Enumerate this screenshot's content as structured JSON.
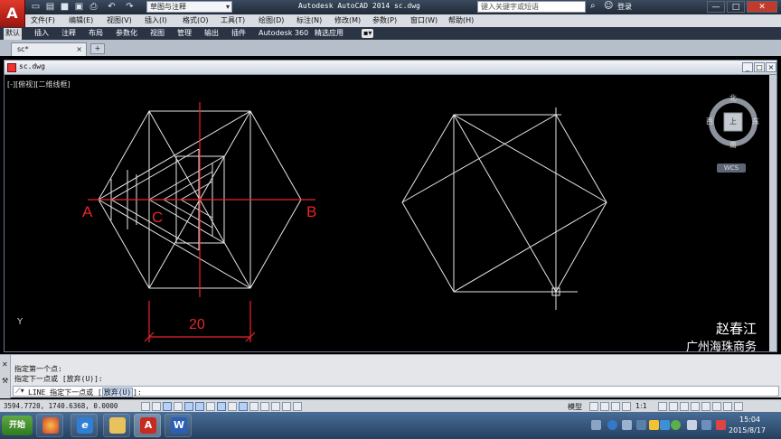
{
  "titlebar": {
    "logo": "A",
    "workspace": "草图与注释",
    "title": "Autodesk AutoCAD 2014    sc.dwg",
    "search_placeholder": "键入关键字或短语",
    "login": "登录",
    "minimize": "—",
    "maximize": "□",
    "close": "✕"
  },
  "menubar": {
    "items": [
      "文件(F)",
      "编辑(E)",
      "视图(V)",
      "插入(I)",
      "格式(O)",
      "工具(T)",
      "绘图(D)",
      "标注(N)",
      "修改(M)",
      "参数(P)",
      "窗口(W)",
      "帮助(H)"
    ]
  },
  "ribbon": {
    "tabs": [
      "默认",
      "插入",
      "注释",
      "布局",
      "参数化",
      "视图",
      "管理",
      "输出",
      "插件",
      "Autodesk 360",
      "精选应用"
    ],
    "active_index": 0
  },
  "doc_tabs": {
    "tab_label": "sc*",
    "tab_close": "×",
    "new_tab": "+"
  },
  "drawing_window": {
    "title": "sc.dwg",
    "viewport_label": "[-][俯视][二维线框]",
    "labels": {
      "a": "A",
      "b": "B",
      "c": "C"
    },
    "dimension": "20",
    "ucs_y": "Y",
    "watermark_name": "赵春江",
    "watermark_company": "广州海珠商务",
    "viewcube": {
      "north": "北",
      "south": "南",
      "east": "东",
      "west": "西",
      "top": "上",
      "wcs": "WCS"
    },
    "colors": {
      "lines": "#e6e6e6",
      "red": "#e8252c",
      "background": "#000000"
    }
  },
  "command": {
    "history": [
      "指定第一个点:",
      "指定下一点或 [放弃(U)]:"
    ],
    "prompt_prefix": "LINE 指定下一点或 [",
    "prompt_option": "放弃(U)",
    "prompt_suffix": "]:"
  },
  "statusbar": {
    "coords": "3594.7720, 1740.6368, 0.0000",
    "model": "模型",
    "scale": "1:1"
  },
  "taskbar": {
    "start": "开始",
    "clock_time": "15:04",
    "clock_date": "2015/8/17"
  }
}
